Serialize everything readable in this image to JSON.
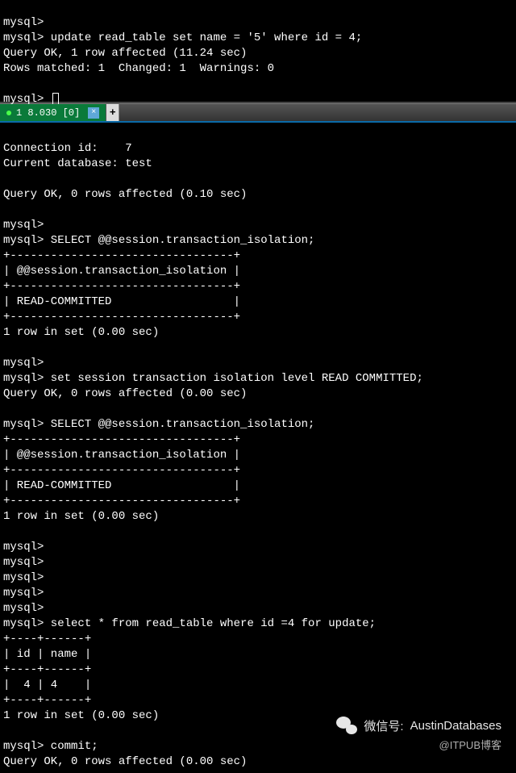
{
  "top": {
    "lines": [
      "mysql>",
      "mysql> update read_table set name = '5' where id = 4;",
      "Query OK, 1 row affected (11.24 sec)",
      "Rows matched: 1  Changed: 1  Warnings: 0",
      "",
      "mysql> "
    ]
  },
  "tab": {
    "label": "1 8.030 [0]",
    "close": "×",
    "new": "+"
  },
  "main": {
    "lines": [
      "Connection id:    7",
      "Current database: test",
      "",
      "Query OK, 0 rows affected (0.10 sec)",
      "",
      "mysql>",
      "mysql> SELECT @@session.transaction_isolation;",
      "+---------------------------------+",
      "| @@session.transaction_isolation |",
      "+---------------------------------+",
      "| READ-COMMITTED                  |",
      "+---------------------------------+",
      "1 row in set (0.00 sec)",
      "",
      "mysql>",
      "mysql> set session transaction isolation level READ COMMITTED;",
      "Query OK, 0 rows affected (0.00 sec)",
      "",
      "mysql> SELECT @@session.transaction_isolation;",
      "+---------------------------------+",
      "| @@session.transaction_isolation |",
      "+---------------------------------+",
      "| READ-COMMITTED                  |",
      "+---------------------------------+",
      "1 row in set (0.00 sec)",
      "",
      "mysql>",
      "mysql>",
      "mysql>",
      "mysql>",
      "mysql>",
      "mysql> select * from read_table where id =4 for update;",
      "+----+------+",
      "| id | name |",
      "+----+------+",
      "|  4 | 4    |",
      "+----+------+",
      "1 row in set (0.00 sec)",
      "",
      "mysql> commit;",
      "Query OK, 0 rows affected (0.00 sec)"
    ]
  },
  "watermark": {
    "wechat_label": "微信号:",
    "wechat_value": "AustinDatabases",
    "itpub": "@ITPUB博客"
  }
}
